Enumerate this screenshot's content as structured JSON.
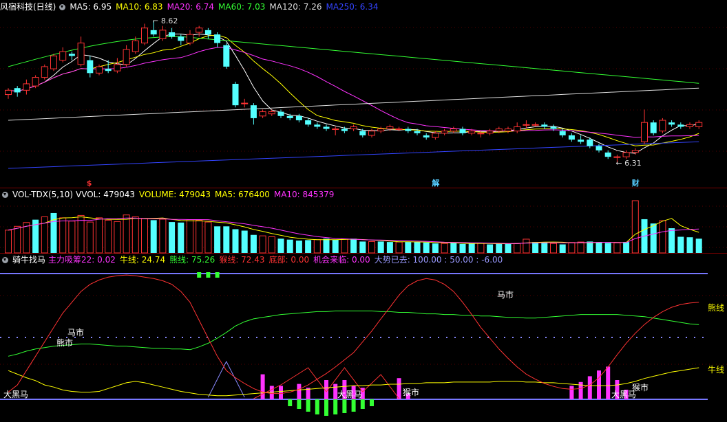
{
  "panel_main": {
    "title": "风宿科技(日线)",
    "ma": [
      {
        "label": "MA5: 6.95",
        "color": "#ffffff"
      },
      {
        "label": "MA10: 6.83",
        "color": "#ffff00"
      },
      {
        "label": "MA20: 6.74",
        "color": "#ff33ff"
      },
      {
        "label": "MA60: 7.03",
        "color": "#33ff33"
      },
      {
        "label": "MA120: 7.26",
        "color": "#dddddd"
      },
      {
        "label": "MA250: 6.34",
        "color": "#3344ff"
      }
    ],
    "high_label": "8.62",
    "low_label": "6.31",
    "markers": [
      "$",
      "解",
      "财"
    ]
  },
  "panel_vol": {
    "title": "VOL-TDX(5,10)",
    "items": [
      {
        "label": "VVOL: 479043",
        "color": "#ffffff"
      },
      {
        "label": "VOLUME: 479043",
        "color": "#ffff00"
      },
      {
        "label": "MA5: 676400",
        "color": "#ffff00"
      },
      {
        "label": "MA10: 845379",
        "color": "#ff33ff"
      }
    ]
  },
  "panel_ind": {
    "title": "骑牛找马",
    "items": [
      {
        "label": "主力吸筹22: 0.02",
        "color": "#ff33ff"
      },
      {
        "label": "牛线: 24.74",
        "color": "#ffff00"
      },
      {
        "label": "熊线: 75.26",
        "color": "#33ff33"
      },
      {
        "label": "猴线: 72.43",
        "color": "#ff3333"
      },
      {
        "label": "底部: 0.00",
        "color": "#ff3333"
      },
      {
        "label": "机会来临: 0.00",
        "color": "#ff33ff"
      },
      {
        "label": "大势已去: 100.00 : 50.00 : -6.00",
        "color": "#9999ff"
      }
    ],
    "texts": {
      "dahei_left": "大黑马",
      "mashi_left": "马市",
      "xiongshi_left": "熊市",
      "dahei_mid": "大黑马",
      "houshi_mid": "猴市",
      "mashi_right": "马市",
      "dahei_right": "大黑马",
      "houshi_right": "猴市",
      "xiong_label": "熊线",
      "niu_label": "牛线"
    }
  },
  "colors": {
    "up": "#ff3333",
    "down": "#54ffff",
    "ma5": "#ffffff",
    "ma10": "#ffff00",
    "ma20": "#ff33ff",
    "ma60": "#33ff33",
    "ma120": "#dddddd",
    "ma250": "#3344ff",
    "niu": "#ffff00",
    "xiong": "#33ff33",
    "hou": "#ff3333",
    "purple": "#7777ff"
  },
  "chart_data": {
    "type": "candlestick",
    "candles": [
      [
        6.9,
        7.0,
        7.05,
        6.8
      ],
      [
        7.05,
        6.95,
        7.1,
        6.85
      ],
      [
        7.0,
        7.15,
        7.25,
        6.9
      ],
      [
        7.1,
        7.3,
        7.35,
        7.05
      ],
      [
        7.3,
        7.55,
        7.6,
        7.25
      ],
      [
        7.5,
        7.8,
        7.85,
        7.45
      ],
      [
        7.7,
        7.9,
        8.0,
        7.65
      ],
      [
        7.85,
        7.8,
        7.9,
        7.7
      ],
      [
        7.6,
        8.1,
        8.25,
        7.55
      ],
      [
        7.7,
        7.4,
        7.8,
        7.3
      ],
      [
        7.4,
        7.55,
        7.6,
        7.35
      ],
      [
        7.5,
        7.45,
        7.7,
        7.4
      ],
      [
        7.45,
        7.6,
        7.75,
        7.4
      ],
      [
        7.6,
        7.95,
        8.05,
        7.55
      ],
      [
        7.9,
        8.15,
        8.25,
        7.85
      ],
      [
        8.1,
        8.45,
        8.55,
        8.05
      ],
      [
        8.4,
        8.3,
        8.62,
        8.25
      ],
      [
        8.2,
        8.4,
        8.5,
        8.15
      ],
      [
        8.35,
        8.25,
        8.45,
        8.2
      ],
      [
        8.25,
        8.15,
        8.3,
        8.05
      ],
      [
        8.1,
        8.3,
        8.4,
        8.05
      ],
      [
        8.35,
        8.45,
        8.5,
        8.25
      ],
      [
        8.4,
        8.3,
        8.45,
        8.2
      ],
      [
        8.3,
        8.1,
        8.35,
        8.0
      ],
      [
        8.05,
        7.55,
        8.1,
        7.5
      ],
      [
        7.15,
        6.65,
        7.2,
        6.6
      ],
      [
        6.7,
        6.7,
        6.8,
        6.6
      ],
      [
        6.65,
        6.35,
        6.7,
        6.2
      ],
      [
        6.4,
        6.5,
        6.55,
        6.35
      ],
      [
        6.45,
        6.5,
        6.55,
        6.4
      ],
      [
        6.5,
        6.4,
        6.55,
        6.35
      ],
      [
        6.4,
        6.35,
        6.45,
        6.3
      ],
      [
        6.4,
        6.3,
        6.45,
        6.25
      ],
      [
        6.3,
        6.2,
        6.35,
        6.15
      ],
      [
        6.2,
        6.15,
        6.25,
        6.1
      ],
      [
        6.15,
        6.1,
        6.2,
        6.05
      ],
      [
        6.1,
        6.1,
        6.15,
        5.95
      ],
      [
        6.1,
        6.05,
        6.15,
        6.0
      ],
      [
        6.1,
        6.15,
        6.2,
        6.05
      ],
      [
        6.05,
        5.95,
        6.1,
        5.9
      ],
      [
        5.95,
        6.05,
        6.1,
        5.9
      ],
      [
        6.05,
        6.1,
        6.15,
        6.0
      ],
      [
        6.1,
        6.15,
        6.2,
        6.05
      ],
      [
        6.1,
        6.1,
        6.15,
        6.05
      ],
      [
        6.1,
        6.05,
        6.15,
        6.0
      ],
      [
        6.05,
        6.0,
        6.1,
        5.95
      ],
      [
        5.95,
        5.9,
        6.0,
        5.85
      ],
      [
        5.9,
        6.0,
        6.05,
        5.85
      ],
      [
        6.0,
        6.05,
        6.1,
        5.95
      ],
      [
        6.05,
        6.1,
        6.15,
        6.0
      ],
      [
        6.1,
        6.0,
        6.15,
        5.95
      ],
      [
        6.0,
        6.05,
        6.1,
        5.95
      ],
      [
        6.0,
        6.0,
        6.05,
        5.9
      ],
      [
        6.0,
        6.05,
        6.1,
        5.95
      ],
      [
        6.05,
        6.1,
        6.15,
        6.0
      ],
      [
        6.05,
        6.1,
        6.15,
        6.0
      ],
      [
        6.05,
        6.15,
        6.25,
        6.0
      ],
      [
        6.2,
        6.2,
        6.3,
        6.1
      ],
      [
        6.2,
        6.2,
        6.25,
        6.15
      ],
      [
        6.2,
        6.15,
        6.25,
        6.1
      ],
      [
        6.15,
        6.1,
        6.2,
        6.05
      ],
      [
        6.05,
        5.95,
        6.1,
        5.9
      ],
      [
        5.95,
        5.85,
        6.0,
        5.8
      ],
      [
        5.85,
        5.8,
        5.95,
        5.75
      ],
      [
        5.85,
        5.7,
        5.9,
        5.65
      ],
      [
        5.7,
        5.6,
        5.75,
        5.55
      ],
      [
        5.55,
        5.45,
        5.6,
        5.4
      ],
      [
        5.45,
        5.45,
        5.5,
        5.31
      ],
      [
        5.45,
        5.55,
        5.6,
        5.4
      ],
      [
        5.55,
        5.6,
        5.65,
        5.5
      ],
      [
        5.8,
        6.25,
        6.55,
        5.75
      ],
      [
        6.25,
        6.0,
        6.3,
        5.95
      ],
      [
        6.05,
        6.3,
        6.35,
        6.0
      ],
      [
        6.25,
        6.2,
        6.3,
        6.15
      ],
      [
        6.2,
        6.15,
        6.25,
        6.1
      ],
      [
        6.15,
        6.2,
        6.25,
        6.1
      ],
      [
        6.15,
        6.25,
        6.3,
        6.1
      ]
    ],
    "volume": [
      [
        480,
        "up"
      ],
      [
        560,
        "up"
      ],
      [
        640,
        "up"
      ],
      [
        700,
        "down"
      ],
      [
        760,
        "up"
      ],
      [
        840,
        "down"
      ],
      [
        740,
        "up"
      ],
      [
        670,
        "up"
      ],
      [
        790,
        "up"
      ],
      [
        650,
        "up"
      ],
      [
        740,
        "up"
      ],
      [
        690,
        "up"
      ],
      [
        660,
        "up"
      ],
      [
        800,
        "up"
      ],
      [
        760,
        "up"
      ],
      [
        720,
        "up"
      ],
      [
        690,
        "down"
      ],
      [
        710,
        "up"
      ],
      [
        650,
        "down"
      ],
      [
        640,
        "down"
      ],
      [
        700,
        "up"
      ],
      [
        690,
        "up"
      ],
      [
        650,
        "up"
      ],
      [
        560,
        "down"
      ],
      [
        560,
        "down"
      ],
      [
        500,
        "down"
      ],
      [
        470,
        "down"
      ],
      [
        380,
        "down"
      ],
      [
        360,
        "up"
      ],
      [
        340,
        "up"
      ],
      [
        300,
        "down"
      ],
      [
        280,
        "down"
      ],
      [
        260,
        "down"
      ],
      [
        270,
        "down"
      ],
      [
        280,
        "up"
      ],
      [
        300,
        "down"
      ],
      [
        280,
        "down"
      ],
      [
        290,
        "up"
      ],
      [
        300,
        "down"
      ],
      [
        240,
        "down"
      ],
      [
        240,
        "up"
      ],
      [
        240,
        "down"
      ],
      [
        230,
        "down"
      ],
      [
        230,
        "up"
      ],
      [
        230,
        "down"
      ],
      [
        230,
        "down"
      ],
      [
        220,
        "down"
      ],
      [
        200,
        "down"
      ],
      [
        200,
        "up"
      ],
      [
        210,
        "down"
      ],
      [
        190,
        "down"
      ],
      [
        200,
        "down"
      ],
      [
        210,
        "up"
      ],
      [
        180,
        "down"
      ],
      [
        200,
        "down"
      ],
      [
        190,
        "down"
      ],
      [
        200,
        "up"
      ],
      [
        290,
        "up"
      ],
      [
        230,
        "down"
      ],
      [
        230,
        "down"
      ],
      [
        200,
        "up"
      ],
      [
        180,
        "down"
      ],
      [
        220,
        "up"
      ],
      [
        230,
        "up"
      ],
      [
        240,
        "down"
      ],
      [
        220,
        "down"
      ],
      [
        210,
        "down"
      ],
      [
        210,
        "up"
      ],
      [
        230,
        "down"
      ],
      [
        1100,
        "up"
      ],
      [
        710,
        "down"
      ],
      [
        620,
        "down"
      ],
      [
        680,
        "up"
      ],
      [
        520,
        "down"
      ],
      [
        340,
        "down"
      ],
      [
        330,
        "down"
      ],
      [
        300,
        "down"
      ]
    ],
    "indicator": {
      "niu": [
        40,
        35,
        30,
        26,
        20,
        17,
        13,
        11,
        10,
        10,
        11,
        15,
        19,
        23,
        25,
        23,
        20,
        17,
        14,
        11,
        9,
        7,
        6,
        5,
        5,
        6,
        7,
        8,
        9,
        10,
        11,
        12,
        13,
        14,
        15,
        16,
        17,
        18,
        19,
        19,
        20,
        20,
        21,
        21,
        22,
        22,
        23,
        23,
        23,
        24,
        24,
        24,
        24,
        24,
        25,
        25,
        25,
        24,
        24,
        23,
        23,
        22,
        21,
        20,
        19,
        19,
        19,
        20,
        22,
        25,
        29,
        32,
        35,
        38,
        40,
        42,
        44
      ],
      "xiong": [
        60,
        63,
        67,
        70,
        72,
        74,
        75,
        76,
        77,
        77,
        76,
        75,
        74,
        74,
        73,
        72,
        71,
        71,
        70,
        70,
        69,
        73,
        78,
        85,
        93,
        102,
        108,
        112,
        114,
        116,
        118,
        119,
        120,
        121,
        122,
        122,
        123,
        123,
        123,
        123,
        123,
        122,
        122,
        121,
        121,
        120,
        119,
        119,
        118,
        118,
        117,
        117,
        116,
        116,
        115,
        114,
        114,
        113,
        113,
        114,
        115,
        116,
        117,
        118,
        118,
        118,
        118,
        118,
        117,
        116,
        115,
        113,
        111,
        109,
        107,
        105,
        104
      ],
      "hou": [
        10,
        20,
        40,
        60,
        80,
        100,
        120,
        135,
        150,
        160,
        166,
        170,
        172,
        173,
        172,
        170,
        168,
        165,
        160,
        150,
        135,
        110,
        85,
        60,
        40,
        30,
        22,
        15,
        10,
        8,
        8,
        10,
        14,
        20,
        28,
        36,
        45,
        55,
        65,
        80,
        95,
        112,
        128,
        145,
        158,
        165,
        168,
        166,
        160,
        150,
        135,
        118,
        100,
        85,
        70,
        57,
        45,
        35,
        28,
        22,
        18,
        15,
        14,
        15,
        20,
        30,
        45,
        62,
        78,
        92,
        104,
        114,
        122,
        128,
        132,
        134,
        135
      ]
    }
  }
}
